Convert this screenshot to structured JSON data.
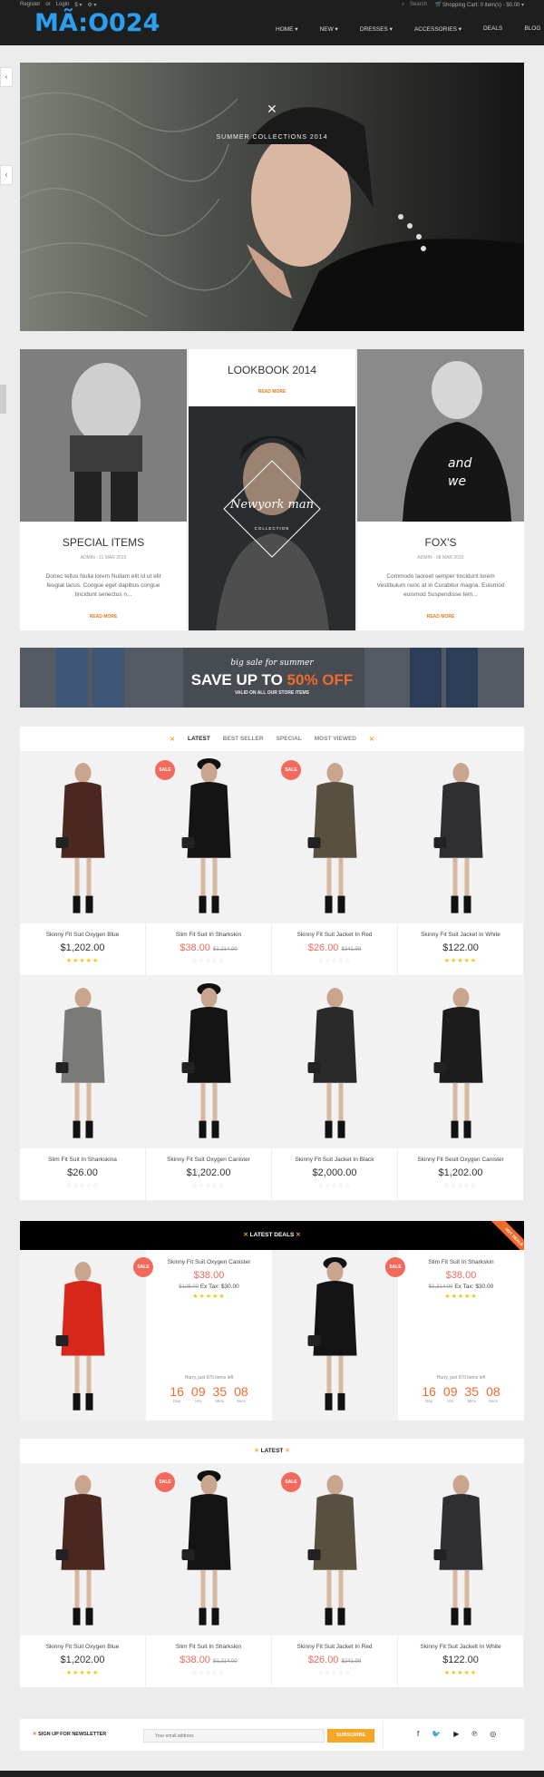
{
  "header": {
    "logo": "MÃ:O024",
    "top_links": [
      "Register",
      "or",
      "Login",
      "$ ▾",
      "⚙ ▾"
    ],
    "search_label": "Search",
    "cart_label": "Shopping Cart: 0 item(s) - $0.00 ▾",
    "nav": [
      "HOME ▾",
      "NEW ▾",
      "DRESSES ▾",
      "ACCESSORIES ▾",
      "DEALS",
      "BLOG"
    ]
  },
  "hero": {
    "caption": "SUMMER COLLECTIONS 2014"
  },
  "blog": [
    {
      "title": "SPECIAL ITEMS",
      "date": "ADMIN - 11 MAR 2015",
      "body": "Donec tellus Nulla lorem Nullam elit id ut elit feugiat lacus. Congue eget dapibus congue tincidunt senectus n...",
      "more": "READ MORE"
    },
    {
      "title": "LOOKBOOK 2014",
      "more": "READ MORE",
      "badge_title": "Newyork man",
      "badge_sub": "COLLECTION"
    },
    {
      "title": "FOX'S",
      "date": "ADMIN - 08 MAR 2015",
      "body": "Commodo laoreet semper tincidunt lorem Vestibulum nunc at in Curabitur magna. Euismod euismod Suspendisse tem...",
      "more": "READ MORE"
    }
  ],
  "promo": {
    "line1": "big sale for summer",
    "line2a": "SAVE UP TO ",
    "line2b": "50% OFF",
    "line3": "VALID ON ALL OUR STORE ITEMS"
  },
  "tabs": [
    "LATEST",
    "BEST SELLER",
    "SPECIAL",
    "MOST VIEWED"
  ],
  "products_row1": [
    {
      "name": "Skinny Fit Suit Oxygen Blue",
      "price": "$1,202.00",
      "old": "",
      "sale": false,
      "stars": 5
    },
    {
      "name": "Slim Fit Suit In Sharkskin",
      "price": "$38.00",
      "old": "$1,214.00",
      "sale": true,
      "stars": 0
    },
    {
      "name": "Skinny Fit Suit Jacket In Red",
      "price": "$26.00",
      "old": "$241.99",
      "sale": true,
      "stars": 0
    },
    {
      "name": "Skinny Fit Suit Jacket In White",
      "price": "$122.00",
      "old": "",
      "sale": false,
      "stars": 5
    }
  ],
  "products_row2": [
    {
      "name": "Slim Fit Suit In Sharkskina",
      "price": "$26.00",
      "stars": 0
    },
    {
      "name": "Skinny Fit Suit Oxygen Canister",
      "price": "$1,202.00",
      "stars": 0
    },
    {
      "name": "Skinny Fit Suit Jacket In Black",
      "price": "$2,000.00",
      "stars": 0
    },
    {
      "name": "Skinny Fit Seuit Oxygen Canister",
      "price": "$1,202.00",
      "stars": 0
    }
  ],
  "sale_label": "SALE",
  "deals": {
    "title": "LATEST DEALS",
    "ribbon": "HOT DEALS",
    "items": [
      {
        "name": "Skinny Fit Suit Oxygen Canister",
        "price": "$38.00",
        "old": "$128.00",
        "extax": "Ex Tax: $30.00",
        "hurry": "Hurry, just 970 items left",
        "days": "16",
        "hrs": "09",
        "min": "35",
        "sec": "08"
      },
      {
        "name": "Slim Fit Suit In Sharkskin",
        "price": "$38.00",
        "old": "$1,314.00",
        "extax": "Ex Tax: $30.00",
        "hurry": "Hurry, just 970 items left",
        "days": "16",
        "hrs": "09",
        "min": "35",
        "sec": "08"
      }
    ],
    "unit_labels": [
      "Day",
      "Hrs",
      "Mins",
      "Secs"
    ]
  },
  "latest": {
    "title": "LATEST",
    "items": [
      {
        "name": "Skinny Fit Suit Oxygen Blue",
        "price": "$1,202.00",
        "old": "",
        "sale": false,
        "stars": 5
      },
      {
        "name": "Slim Fit Suit In Sharkskin",
        "price": "$38.00",
        "old": "$1,214.00",
        "sale": true,
        "stars": 0
      },
      {
        "name": "Skinny Fit Suit Jacket In Red",
        "price": "$26.00",
        "old": "$241.99",
        "sale": true,
        "stars": 0
      },
      {
        "name": "Skinny Fit Suit Jackelt In White",
        "price": "$122.00",
        "old": "",
        "sale": false,
        "stars": 5
      }
    ]
  },
  "newsletter": {
    "label": "SIGN UP FOR NEWSLETTER",
    "placeholder": "Your email address",
    "button": "SUBSCRIBE",
    "social_icons": [
      "facebook-icon",
      "twitter-icon",
      "youtube-icon",
      "pinterest-icon",
      "dribbble-icon"
    ]
  },
  "colors": {
    "accent": "#f16a2b",
    "sale": "#f16a5b",
    "logo": "#2a9ff0"
  }
}
